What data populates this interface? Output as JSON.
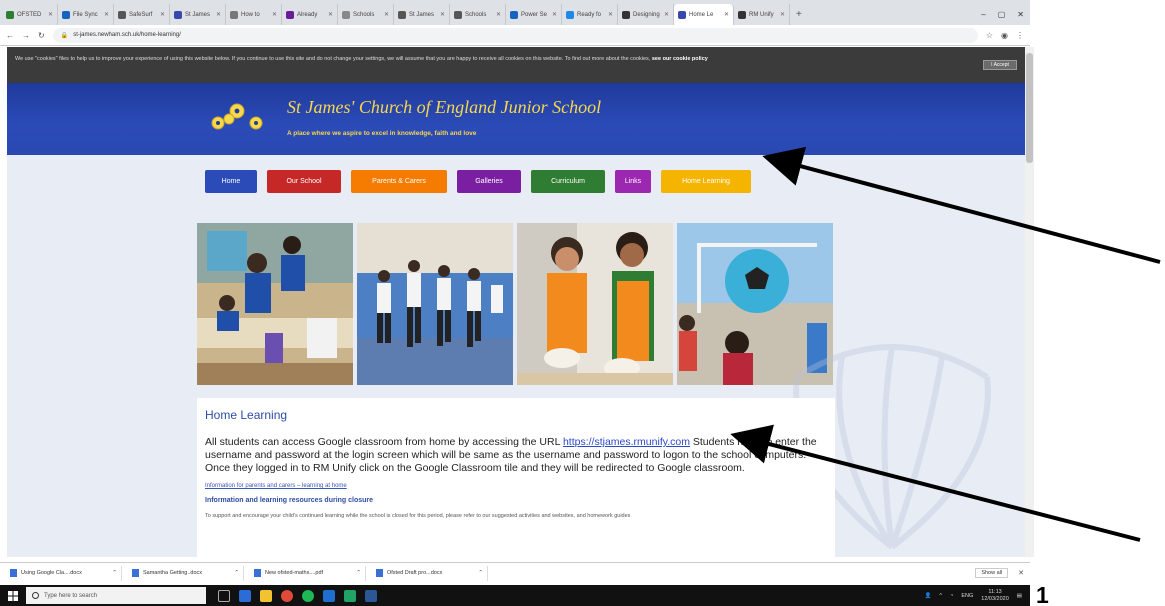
{
  "browser": {
    "tabs": [
      {
        "label": "OFSTED",
        "color": "#2e7d32"
      },
      {
        "label": "File Sync",
        "color": "#1565c0"
      },
      {
        "label": "SafeSurf",
        "color": "#555555"
      },
      {
        "label": "St James",
        "color": "#3949ab"
      },
      {
        "label": "How to",
        "color": "#777777"
      },
      {
        "label": "Already",
        "color": "#6a1b9a"
      },
      {
        "label": "Schools",
        "color": "#888888"
      },
      {
        "label": "St James",
        "color": "#555555"
      },
      {
        "label": "Schools",
        "color": "#555555"
      },
      {
        "label": "Power Se",
        "color": "#1565c0"
      },
      {
        "label": "Ready fo",
        "color": "#1e88e5"
      },
      {
        "label": "Designing",
        "color": "#333333"
      },
      {
        "label": "Home Le",
        "color": "#3949ab"
      },
      {
        "label": "RM Unify",
        "color": "#333333"
      }
    ],
    "url": "st-james.newham.sch.uk/home-learning/"
  },
  "cookie": {
    "text": "We use \"cookies\" files to help us to improve your experience of using this website below. If you continue to use this site and do not change your settings, we will assume that you are happy to receive all cookies on this website. To find out more about the cookies,",
    "link": "see our cookie policy",
    "button": "I Accept"
  },
  "header": {
    "school_name": "St James' Church of England Junior School",
    "tagline": "A place where we aspire to excel in knowledge, faith and love"
  },
  "nav": [
    {
      "label": "Home",
      "color": "#2a4bb8"
    },
    {
      "label": "Our School",
      "color": "#c62828"
    },
    {
      "label": "Parents & Carers",
      "color": "#f57c00"
    },
    {
      "label": "Galleries",
      "color": "#7b1fa2"
    },
    {
      "label": "Curriculum",
      "color": "#2e7d32"
    },
    {
      "label": "Links",
      "color": "#9c27b0"
    },
    {
      "label": "Home Learning",
      "color": "#f4b400"
    }
  ],
  "content": {
    "heading": "Home Learning",
    "para_start": "All students can access Google classroom from home by accessing the URL",
    "url": "https://stjames.rmunify.com",
    "para_rest": "Students need to enter the username and password at the login screen which will be same as the username and password to logon to the school computers. Once they logged in to RM Unify click on the Google Classroom tile and they will be redirected to Google classroom.",
    "small_link": "Information for parents and carers – learning at home",
    "subheading": "Information and learning resources during closure",
    "cut_text": "To support and encourage your child's continued learning while the school is closed for this period, please refer to our suggested activities and websites, and homework guides"
  },
  "downloads": {
    "items": [
      "Using Google Cla....docx",
      "Samantha Getting..docx",
      "New ofsted-maths....pdf",
      "Ofsted Draft pro...docx"
    ],
    "show_all": "Show all"
  },
  "taskbar": {
    "search_placeholder": "Type here to search",
    "time": "11:13",
    "date": "12/03/2020",
    "lang": "ENG"
  },
  "annotation": {
    "number": "1"
  }
}
